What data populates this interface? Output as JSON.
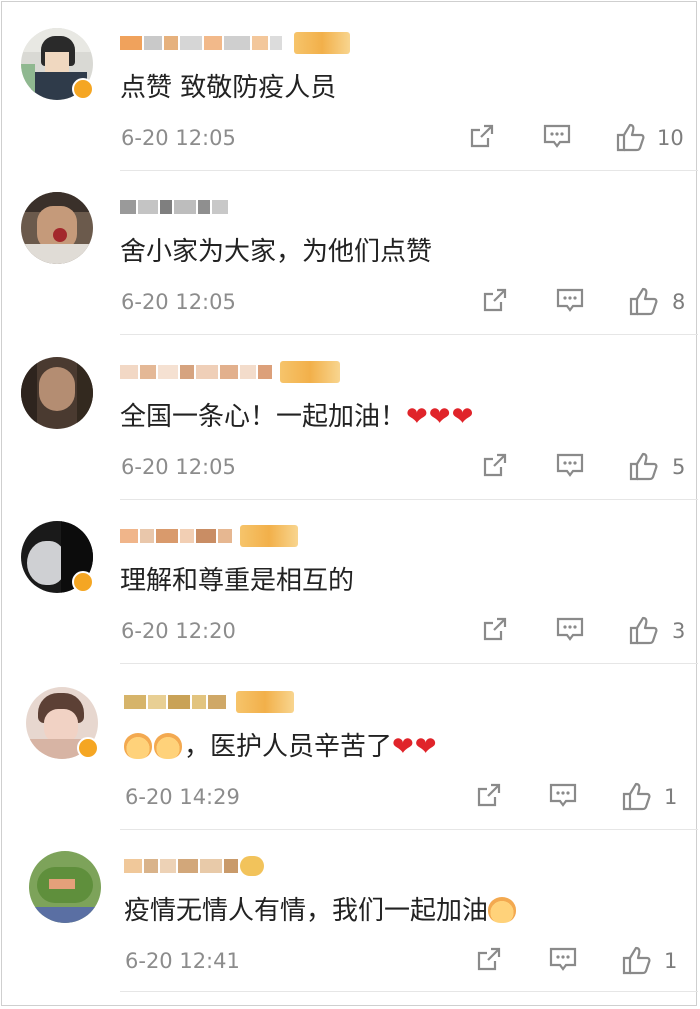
{
  "comments": [
    {
      "text": "点赞  致敬防疫人员",
      "time": "6-20 12:05",
      "likes": "10",
      "verified": true,
      "hearts": "",
      "emoji": ""
    },
    {
      "text": "舍小家为大家，为他们点赞",
      "time": "6-20 12:05",
      "likes": "8",
      "verified": false,
      "hearts": "",
      "emoji": ""
    },
    {
      "text": "全国一条心！一起加油！",
      "time": "6-20 12:05",
      "likes": "5",
      "verified": false,
      "hearts": "❤❤❤",
      "emoji": ""
    },
    {
      "text": "理解和尊重是相互的",
      "time": "6-20 12:20",
      "likes": "3",
      "verified": true,
      "hearts": "",
      "emoji": ""
    },
    {
      "text": "，医护人员辛苦了",
      "time": "6-20 14:29",
      "likes": "1",
      "verified": true,
      "hearts": "❤❤",
      "emoji": "clap-hands-emoji-x2"
    },
    {
      "text": "疫情无情人有情，我们一起加油",
      "time": "6-20 12:41",
      "likes": "1",
      "verified": false,
      "hearts": "",
      "emoji": "clap-hands-emoji-end"
    }
  ],
  "icons": {
    "share": "share-icon",
    "reply": "comment-icon",
    "like": "thumbs-up-icon"
  },
  "colors": {
    "text": "#222222",
    "meta": "#8c8c8c",
    "heart": "#e0242a",
    "badge": "#f5a623",
    "divider": "#e6e6e6"
  }
}
